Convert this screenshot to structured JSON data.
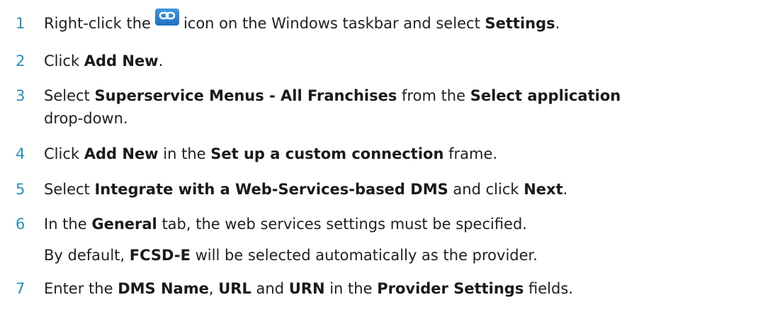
{
  "steps": [
    {
      "num": "1",
      "parts": [
        "Right-click the",
        "icon on the Windows taskbar and select",
        "Settings",
        "."
      ]
    },
    {
      "num": "2",
      "parts": [
        "Click",
        "Add New",
        "."
      ]
    },
    {
      "num": "3",
      "parts": [
        "Select",
        "Superservice Menus - All Franchises",
        "from the",
        "Select application"
      ],
      "cont": "drop-down."
    },
    {
      "num": "4",
      "parts": [
        "Click",
        "Add New",
        "in the",
        "Set up a custom connection",
        "frame."
      ]
    },
    {
      "num": "5",
      "parts": [
        "Select",
        "Integrate with a Web-Services-based DMS",
        "and click",
        "Next",
        "."
      ]
    },
    {
      "num": "6",
      "parts": [
        "In the",
        "General",
        "tab, the web services settings must be specified."
      ],
      "note": [
        "By default,",
        "FCSD-E",
        "will be selected automatically as the provider."
      ]
    },
    {
      "num": "7",
      "parts": [
        "Enter the",
        "DMS Name",
        ",",
        "URL",
        "and",
        "URN",
        "in the",
        "Provider Settings",
        "fields."
      ]
    }
  ],
  "icons": {
    "taskbar": "link-chain-icon"
  },
  "colors": {
    "step_number": "#2a8fbd",
    "icon_bg": "#2f86d6"
  }
}
